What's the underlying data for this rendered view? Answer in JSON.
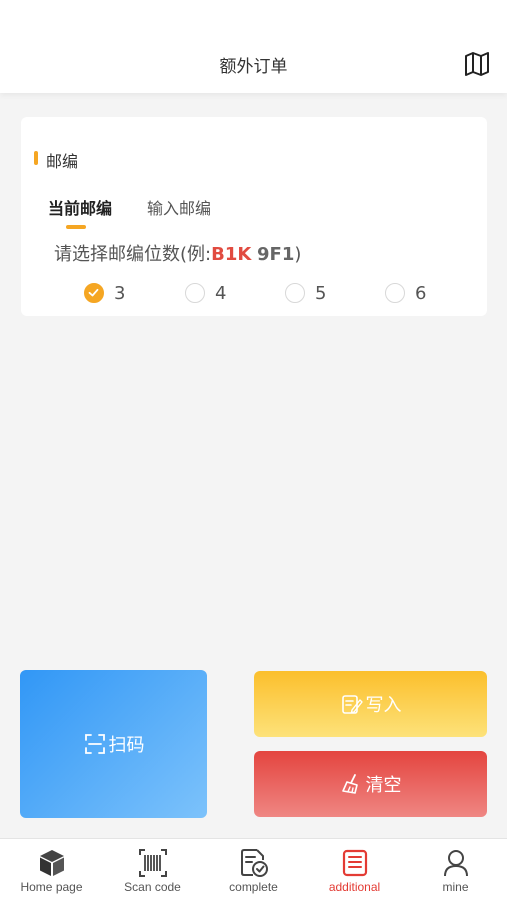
{
  "header": {
    "title": "额外订单",
    "map_icon": "map-icon"
  },
  "section": {
    "title": "邮编"
  },
  "tabs": [
    {
      "label": "当前邮编",
      "active": true
    },
    {
      "label": "输入邮编",
      "active": false
    }
  ],
  "prompt": {
    "prefix": "请选择邮编位数(例:",
    "example_part1": "B1K",
    "example_part2": "9F1",
    "suffix": ")"
  },
  "digit_options": [
    {
      "label": "3",
      "checked": true
    },
    {
      "label": "4",
      "checked": false
    },
    {
      "label": "5",
      "checked": false
    },
    {
      "label": "6",
      "checked": false
    }
  ],
  "buttons": {
    "scan": {
      "label": "扫码",
      "icon": "scan-frame-icon"
    },
    "write": {
      "label": "写入",
      "icon": "edit-note-icon"
    },
    "clear": {
      "label": "清空",
      "icon": "broom-icon"
    }
  },
  "colors": {
    "accent": "#f5a623",
    "active_tab": "#e33b34",
    "scan_blue": "#3197f6",
    "write_yellow": "#fbbf2c",
    "clear_red": "#e4453f"
  },
  "tabbar": [
    {
      "label": "Home page",
      "icon": "box-icon",
      "active": false
    },
    {
      "label": "Scan code",
      "icon": "barcode-icon",
      "active": false
    },
    {
      "label": "complete",
      "icon": "document-check-icon",
      "active": false
    },
    {
      "label": "additional",
      "icon": "receipt-icon",
      "active": true
    },
    {
      "label": "mine",
      "icon": "user-icon",
      "active": false
    }
  ]
}
